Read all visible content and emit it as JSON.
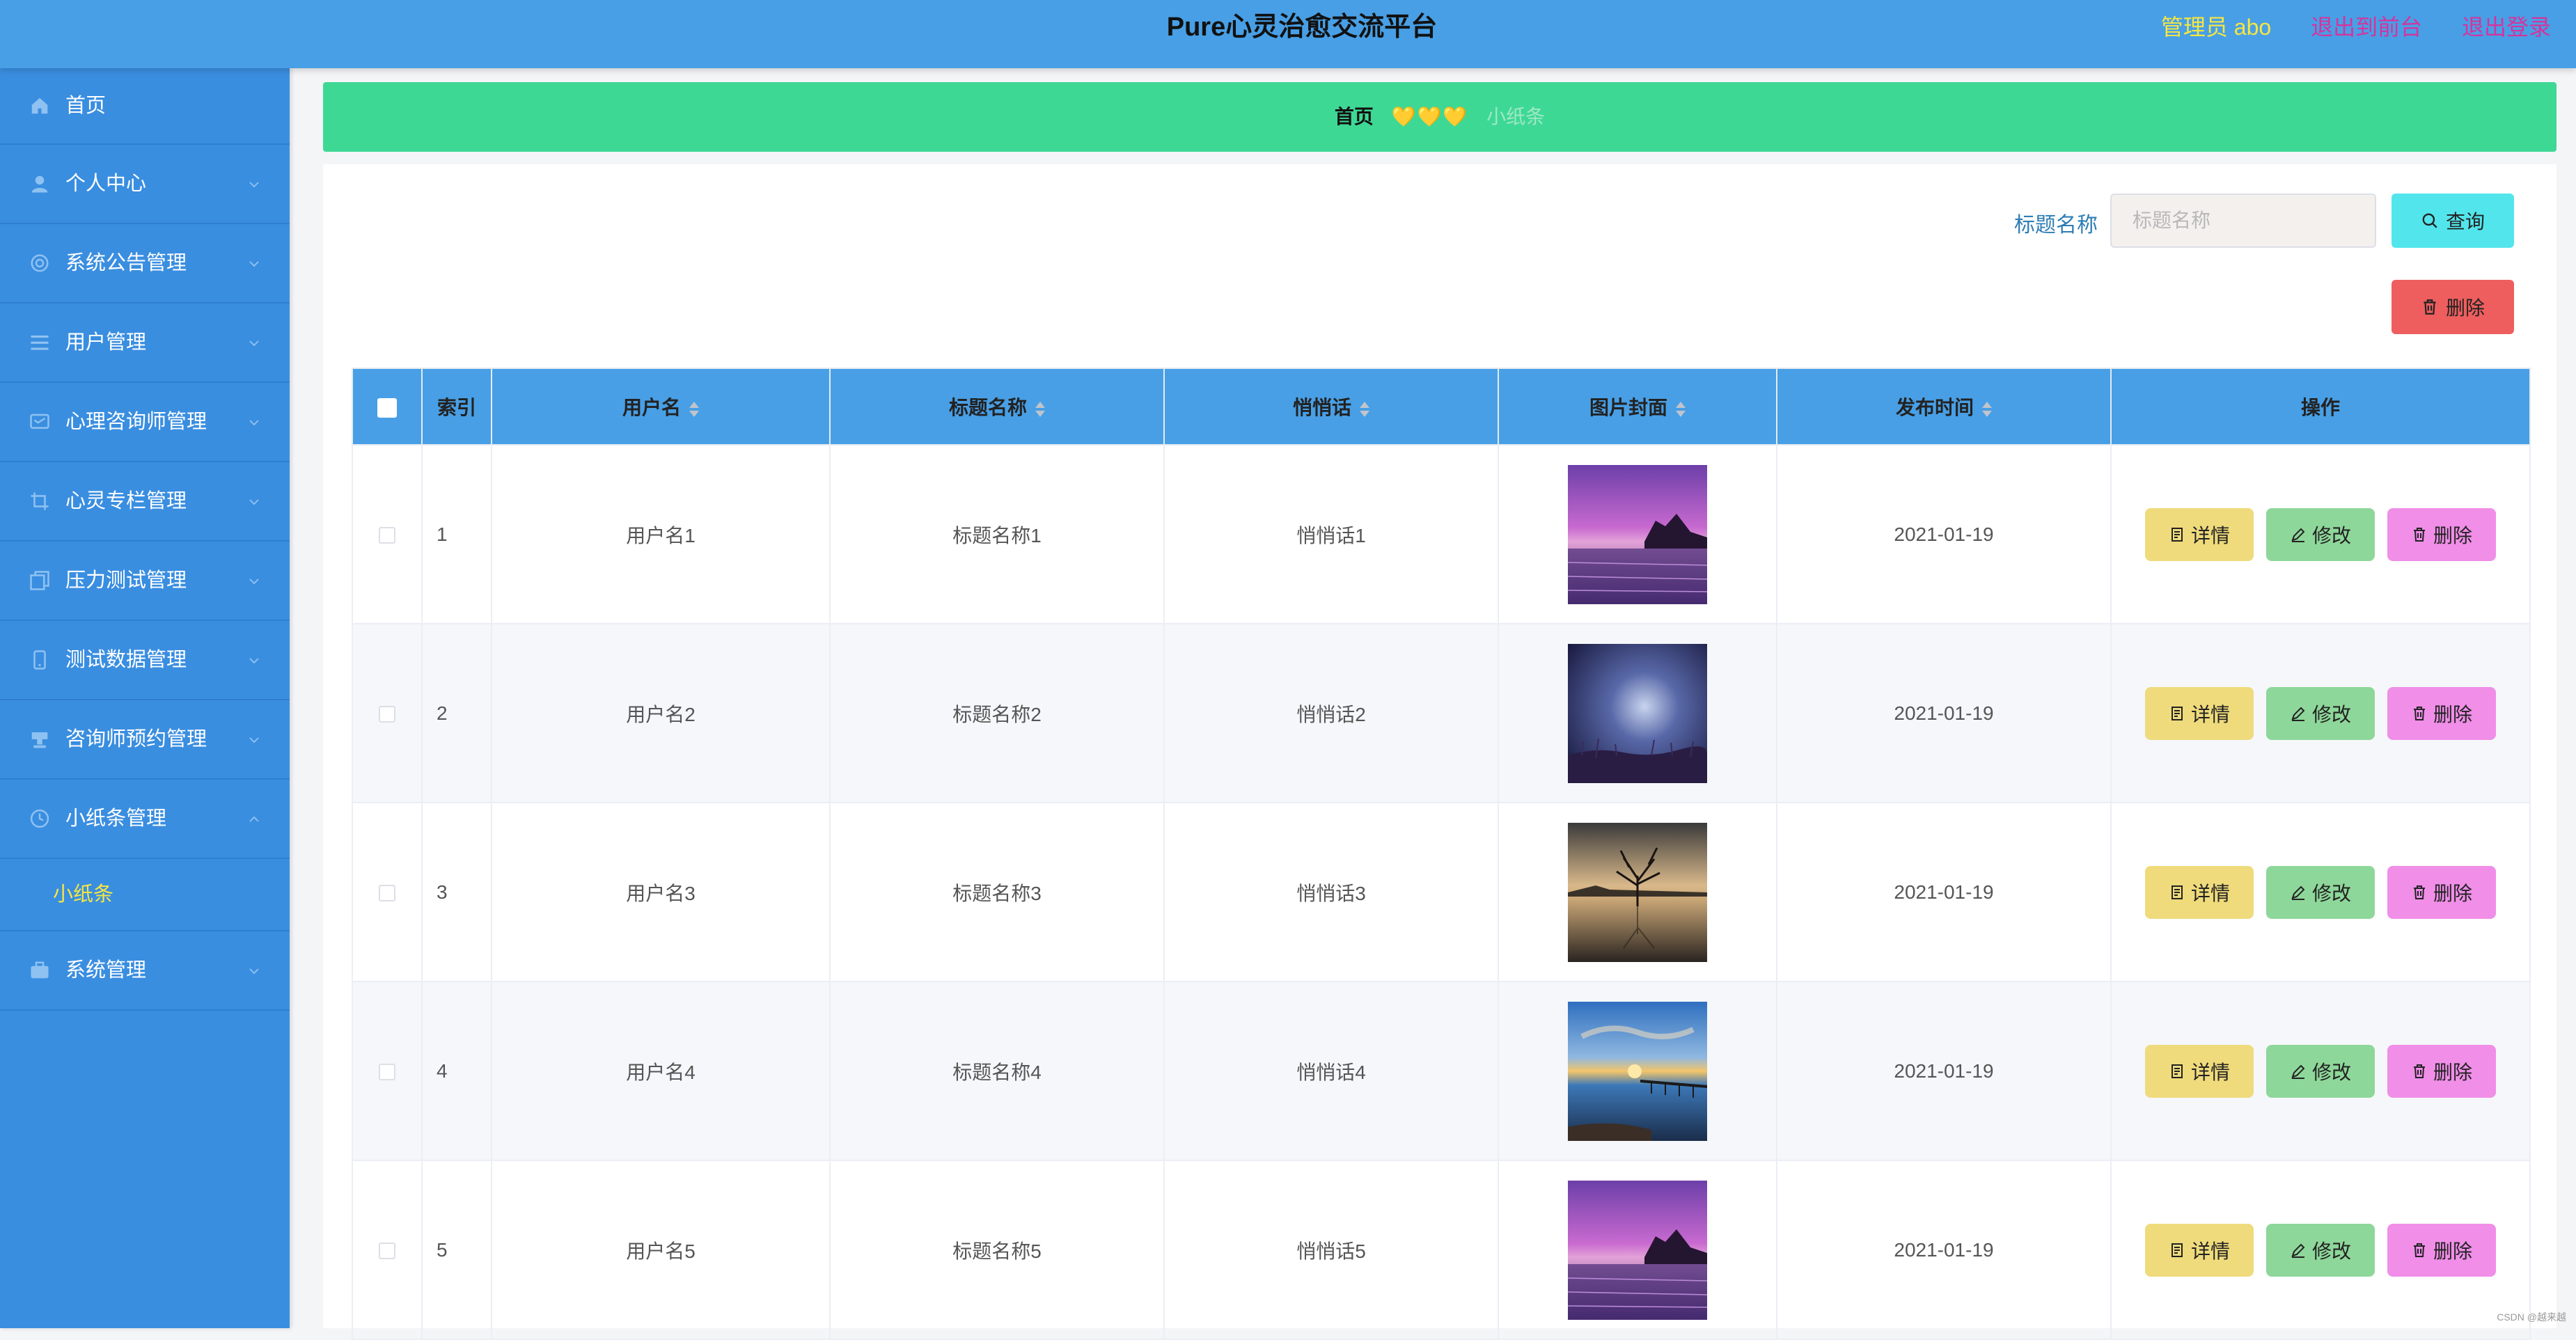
{
  "header": {
    "title": "Pure心灵治愈交流平台",
    "user": "管理员 abo",
    "to_front": "退出到前台",
    "logout": "退出登录"
  },
  "sidebar": {
    "items": [
      {
        "label": "首页",
        "icon": "home-icon"
      },
      {
        "label": "个人中心",
        "icon": "user-icon"
      },
      {
        "label": "系统公告管理",
        "icon": "settings-icon"
      },
      {
        "label": "用户管理",
        "icon": "list-icon"
      },
      {
        "label": "心理咨询师管理",
        "icon": "message-icon"
      },
      {
        "label": "心灵专栏管理",
        "icon": "crop-icon"
      },
      {
        "label": "压力测试管理",
        "icon": "copy-icon"
      },
      {
        "label": "测试数据管理",
        "icon": "phone-icon"
      },
      {
        "label": "咨询师预约管理",
        "icon": "stamp-icon"
      },
      {
        "label": "小纸条管理",
        "icon": "clock-icon"
      },
      {
        "label": "系统管理",
        "icon": "briefcase-icon"
      }
    ],
    "submenu": {
      "label": "小纸条"
    }
  },
  "breadcrumb": {
    "home": "首页",
    "separator": "💛💛💛",
    "current": "小纸条"
  },
  "search": {
    "label": "标题名称",
    "placeholder": "标题名称",
    "value": "",
    "query_button": "查询",
    "delete_button": "删除"
  },
  "table": {
    "headers": {
      "index": "索引",
      "username": "用户名",
      "title": "标题名称",
      "whisper": "悄悄话",
      "cover": "图片封面",
      "time": "发布时间",
      "ops": "操作"
    },
    "rows": [
      {
        "index": "1",
        "username": "用户名1",
        "title": "标题名称1",
        "whisper": "悄悄话1",
        "cover": "purple-sea-rock",
        "time": "2021-01-19"
      },
      {
        "index": "2",
        "username": "用户名2",
        "title": "标题名称2",
        "whisper": "悄悄话2",
        "cover": "night-sky-meadow",
        "time": "2021-01-19"
      },
      {
        "index": "3",
        "username": "用户名3",
        "title": "标题名称3",
        "whisper": "悄悄话3",
        "cover": "lake-tree",
        "time": "2021-01-19"
      },
      {
        "index": "4",
        "username": "用户名4",
        "title": "标题名称4",
        "whisper": "悄悄话4",
        "cover": "sunset-pier",
        "time": "2021-01-19"
      },
      {
        "index": "5",
        "username": "用户名5",
        "title": "标题名称5",
        "whisper": "悄悄话5",
        "cover": "purple-sea-rock",
        "time": "2021-01-19"
      }
    ],
    "actions": {
      "detail": "详情",
      "edit": "修改",
      "delete": "删除"
    }
  },
  "watermark": "CSDN @越来越",
  "colors": {
    "header_bg": "#489fe5",
    "sidebar_bg": "#3a8ee0",
    "breadcrumb_bg": "#3ed895",
    "detail_btn": "#efdb7c",
    "edit_btn": "#8ed79a",
    "delete_btn": "#f08ee8",
    "query_btn": "#53e5ec",
    "danger_btn": "#ee5e5e"
  }
}
